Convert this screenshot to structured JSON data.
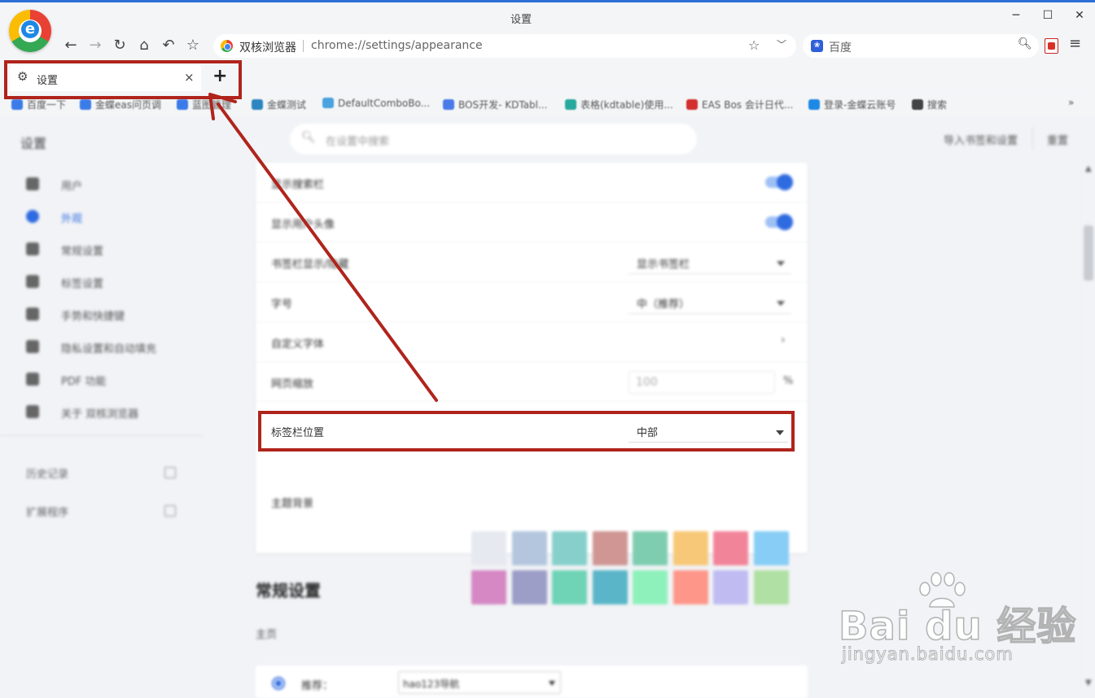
{
  "window": {
    "title": "设置"
  },
  "address_bar": {
    "browser_name": "双核浏览器",
    "url": "chrome://settings/appearance"
  },
  "search_bar": {
    "engine": "百度"
  },
  "tab": {
    "title": "设置",
    "close": "×",
    "new_tab": "+"
  },
  "bookmarks": [
    {
      "label": "百度一下",
      "color": "#3b7be8"
    },
    {
      "label": "金蝶eas问页调",
      "color": "#3b7be8"
    },
    {
      "label": "蓝图管理",
      "color": "#3b7be8"
    },
    {
      "label": "金蝶测试",
      "color": "#2e86c1"
    },
    {
      "label": "DefaultComboBo...",
      "color": "#4aa3df"
    },
    {
      "label": "BOS开发- KDTabl...",
      "color": "#4a7be8"
    },
    {
      "label": "表格(kdtable)使用...",
      "color": "#28a99e"
    },
    {
      "label": "EAS Bos 会计日代...",
      "color": "#d32f2f"
    },
    {
      "label": "登录-金蝶云账号",
      "color": "#1e88e5"
    },
    {
      "label": "搜索",
      "color": "#444444"
    }
  ],
  "settings": {
    "title": "设置",
    "search_placeholder": "在设置中搜索",
    "import_label": "导入书签和设置",
    "reset_label": "重置",
    "sidebar": [
      {
        "label": "用户",
        "icon": "user-icon"
      },
      {
        "label": "外观",
        "icon": "palette-icon",
        "active": true
      },
      {
        "label": "常规设置",
        "icon": "wrench-icon"
      },
      {
        "label": "标签设置",
        "icon": "tab-icon"
      },
      {
        "label": "手势和快捷键",
        "icon": "mouse-icon"
      },
      {
        "label": "隐私设置和自动填充",
        "icon": "shield-icon"
      },
      {
        "label": "PDF 功能",
        "icon": "pdf-icon"
      },
      {
        "label": "关于 双核浏览器",
        "icon": "info-icon"
      }
    ],
    "history_link": "历史记录",
    "extensions_link": "扩展程序",
    "appearance": {
      "show_search_bar": "显示搜索栏",
      "show_avatar": "显示用户头像",
      "bookmark_bar_label": "书签栏显示/隐藏",
      "bookmark_bar_value": "显示书签栏",
      "font_size_label": "字号",
      "font_size_value": "中（推荐）",
      "custom_font_label": "自定义字体",
      "custom_font_arrow": "›",
      "zoom_label": "网页缩放",
      "zoom_value": "100",
      "zoom_unit": "%",
      "tab_position_label": "标签栏位置",
      "tab_position_value": "中部",
      "theme_label": "主题背景",
      "theme_colors": [
        "#e6e9ef",
        "#b3c6de",
        "#86cfcb",
        "#cf9694",
        "#7ecdb0",
        "#f7c877",
        "#f2849a",
        "#87cdf5",
        "#d588c4",
        "#9c9ec8",
        "#6fd3b5",
        "#5ab5c8",
        "#8ef1bb",
        "#fe968a",
        "#c0bcf2",
        "#b0e0a3"
      ]
    },
    "general": {
      "section_title": "常规设置",
      "homepage_label": "主页",
      "recommend_label": "推荐：",
      "recommend_value": "hao123导航"
    }
  },
  "watermark": {
    "brand": "Bai du 经验",
    "site": "jingyan.baidu.com"
  }
}
